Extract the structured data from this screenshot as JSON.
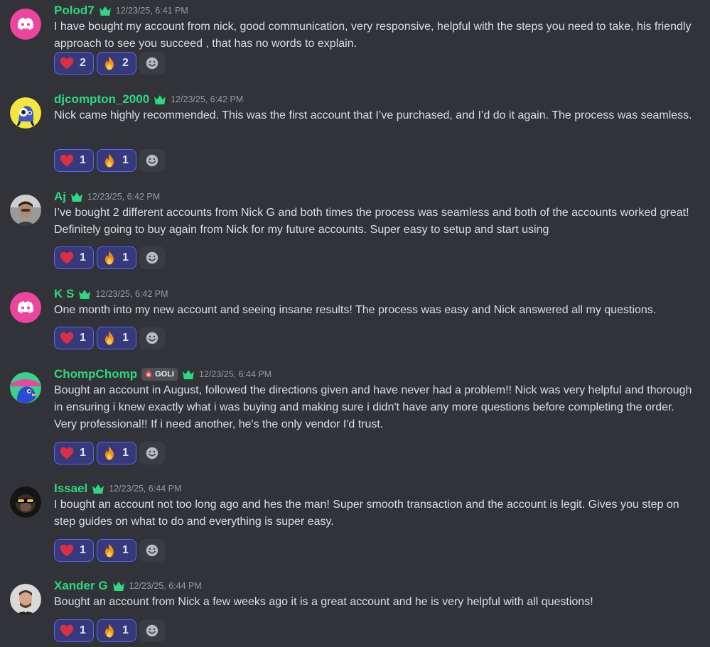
{
  "colors": {
    "background": "#313338",
    "username": "#2dd87f",
    "reaction_border": "#5865f2",
    "reaction_bg": "#373a7a",
    "timestamp": "#949ba4"
  },
  "messages": [
    {
      "username": "Polod7",
      "timestamp": "12/23/25, 6:41 PM",
      "avatar": "discord-logo-avatar-pink",
      "content": "I have bought my account from nick, good communication, very responsive, helpful with the steps you need to take, his friendly approach to see you succeed , that has no words to explain.",
      "reactions": [
        {
          "emoji": "heart-icon",
          "count": "2"
        },
        {
          "emoji": "fire-icon",
          "count": "2"
        }
      ]
    },
    {
      "username": "djcompton_2000",
      "timestamp": "12/23/25, 6:42 PM",
      "avatar": "blue-cartoon-avatar",
      "content": "Nick came highly recommended. This was the first account that I’ve purchased, and I’d do it again. The process was seamless.",
      "reactions": [
        {
          "emoji": "heart-icon",
          "count": "1"
        },
        {
          "emoji": "fire-icon",
          "count": "1"
        }
      ]
    },
    {
      "username": "Aj",
      "timestamp": "12/23/25, 6:42 PM",
      "avatar": "photo-avatar",
      "content": "I’ve bought 2 different accounts from Nick G and both times the process was seamless and both of the accounts worked great! Definitely going to buy again from Nick for my future accounts. Super easy to setup and start using",
      "reactions": [
        {
          "emoji": "heart-icon",
          "count": "1"
        },
        {
          "emoji": "fire-icon",
          "count": "1"
        }
      ]
    },
    {
      "username": "K S",
      "timestamp": "12/23/25, 6:42 PM",
      "avatar": "discord-logo-avatar-pink",
      "content": "One month into my new account and seeing insane results! The process was easy and Nick answered all my questions.",
      "reactions": [
        {
          "emoji": "heart-icon",
          "count": "1"
        },
        {
          "emoji": "fire-icon",
          "count": "1"
        }
      ]
    },
    {
      "username": "ChompChomp",
      "tag": "GOLI",
      "timestamp": "12/23/25, 6:44 PM",
      "avatar": "cartoon-bird-avatar",
      "content": "Bought an account in August,  followed the directions given and have never had a problem!!  Nick was very helpful and thorough in ensuring i knew exactly what i was buying and making sure i didn't have any more questions before completing the order.   Very professional!!  If i need another,  he's the only vendor I'd trust.",
      "reactions": [
        {
          "emoji": "heart-icon",
          "count": "1"
        },
        {
          "emoji": "fire-icon",
          "count": "1"
        }
      ]
    },
    {
      "username": "Issael",
      "timestamp": "12/23/25, 6:44 PM",
      "avatar": "monkey-avatar",
      "content": "I bought an account not too long ago and hes the man! Super smooth transaction and the account is legit. Gives you step on step guides on what to do and everything is super easy.",
      "reactions": [
        {
          "emoji": "heart-icon",
          "count": "1"
        },
        {
          "emoji": "fire-icon",
          "count": "1"
        }
      ]
    },
    {
      "username": "Xander G",
      "timestamp": "12/23/25, 6:44 PM",
      "avatar": "photo-avatar",
      "content": "Bought an account from Nick a few weeks ago it is a great account and he is very helpful with all questions!",
      "reactions": [
        {
          "emoji": "heart-icon",
          "count": "1"
        },
        {
          "emoji": "fire-icon",
          "count": "1"
        }
      ]
    }
  ]
}
